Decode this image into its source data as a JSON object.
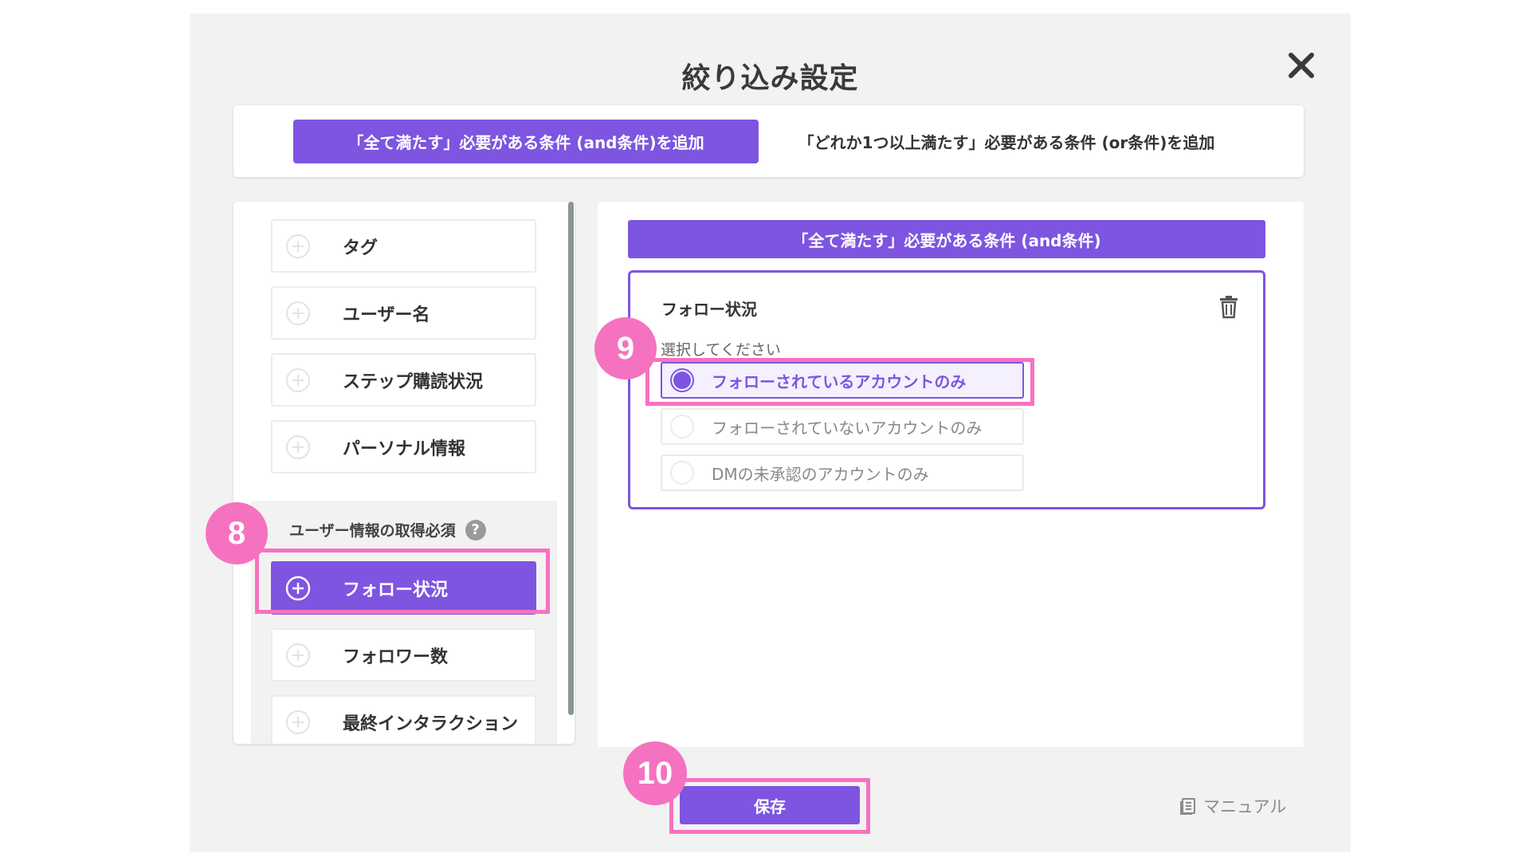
{
  "modal": {
    "title": "絞り込み設定"
  },
  "tabs": [
    {
      "label": "「全て満たす」必要がある条件 (and条件)を追加",
      "active": true
    },
    {
      "label": "「どれか1つ以上満たす」必要がある条件 (or条件)を追加",
      "active": false
    }
  ],
  "left_panel": {
    "items": [
      {
        "label": "タグ"
      },
      {
        "label": "ユーザー名"
      },
      {
        "label": "ステップ購読状況"
      },
      {
        "label": "パーソナル情報"
      }
    ],
    "group": {
      "label": "ユーザー情報の取得必須",
      "help": "?",
      "items": [
        {
          "label": "フォロー状況",
          "selected": true
        },
        {
          "label": "フォロワー数"
        },
        {
          "label": "最終インタラクション"
        }
      ]
    }
  },
  "right_panel": {
    "header": "「全て満たす」必要がある条件 (and条件)",
    "condition": {
      "title": "フォロー状況",
      "select_label": "選択してください",
      "options": [
        {
          "label": "フォローされているアカウントのみ",
          "checked": true
        },
        {
          "label": "フォローされていないアカウントのみ",
          "checked": false
        },
        {
          "label": "DMの未承認のアカウントのみ",
          "checked": false
        }
      ]
    }
  },
  "footer": {
    "save_label": "保存",
    "manual_label": "マニュアル"
  },
  "annotations": {
    "badges": [
      "8",
      "9",
      "10"
    ]
  },
  "colors": {
    "accent": "#7d55e0",
    "highlight": "#f572c0",
    "modal_bg": "#f2f2f2"
  }
}
